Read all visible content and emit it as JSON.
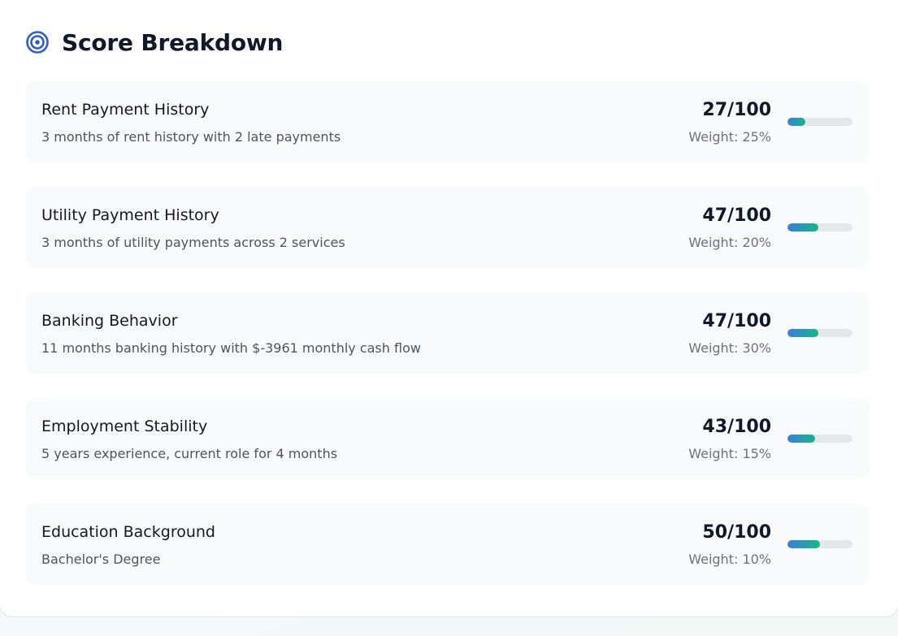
{
  "header": {
    "title": "Score Breakdown",
    "icon": "target-icon",
    "icon_color": "#2f5fc4"
  },
  "colors": {
    "bar_start": "#3b7ddd",
    "bar_end": "#14b88a",
    "bar_track": "#e5e7eb"
  },
  "rows": [
    {
      "name": "Rent Payment History",
      "description": "3 months of rent history with 2 late payments",
      "score": "27/100",
      "score_value": 27,
      "weight": "Weight: 25%"
    },
    {
      "name": "Utility Payment History",
      "description": "3 months of utility payments across 2 services",
      "score": "47/100",
      "score_value": 47,
      "weight": "Weight: 20%"
    },
    {
      "name": "Banking Behavior",
      "description": "11 months banking history with $-3961 monthly cash flow",
      "score": "47/100",
      "score_value": 47,
      "weight": "Weight: 30%"
    },
    {
      "name": "Employment Stability",
      "description": "5 years experience, current role for 4 months",
      "score": "43/100",
      "score_value": 43,
      "weight": "Weight: 15%"
    },
    {
      "name": "Education Background",
      "description": "Bachelor's Degree",
      "score": "50/100",
      "score_value": 50,
      "weight": "Weight: 10%"
    }
  ]
}
